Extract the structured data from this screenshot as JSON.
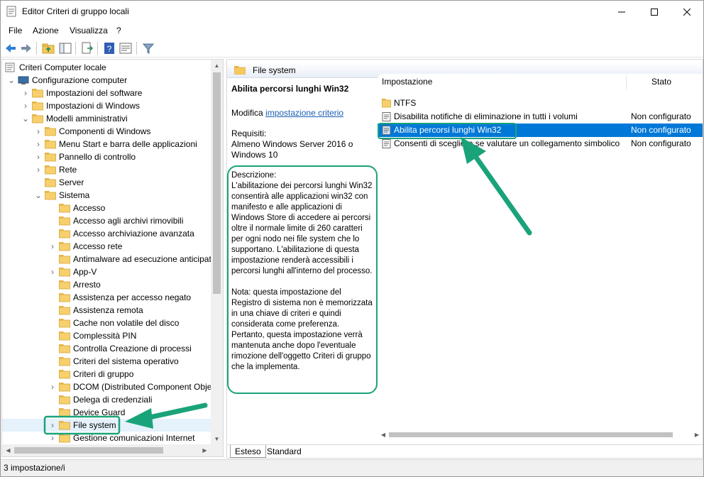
{
  "window": {
    "title": "Editor Criteri di gruppo locali"
  },
  "menu": [
    "File",
    "Azione",
    "Visualizza",
    "?"
  ],
  "tree": [
    {
      "label": "Criteri Computer locale",
      "level": 0,
      "chevron": "",
      "icon": "computer-icon"
    },
    {
      "label": "Configurazione computer",
      "level": 1,
      "chevron": "open",
      "icon": "settings-icon"
    },
    {
      "label": "Impostazioni del software",
      "level": 2,
      "chevron": "closed",
      "icon": "folder-icon"
    },
    {
      "label": "Impostazioni di Windows",
      "level": 2,
      "chevron": "closed",
      "icon": "folder-icon"
    },
    {
      "label": "Modelli amministrativi",
      "level": 2,
      "chevron": "open",
      "icon": "folder-icon"
    },
    {
      "label": "Componenti di Windows",
      "level": 3,
      "chevron": "closed",
      "icon": "folder-icon"
    },
    {
      "label": "Menu Start e barra delle applicazioni",
      "level": 3,
      "chevron": "closed",
      "icon": "folder-icon"
    },
    {
      "label": "Pannello di controllo",
      "level": 3,
      "chevron": "closed",
      "icon": "folder-icon"
    },
    {
      "label": "Rete",
      "level": 3,
      "chevron": "closed",
      "icon": "folder-icon"
    },
    {
      "label": "Server",
      "level": 3,
      "chevron": "",
      "icon": "folder-icon"
    },
    {
      "label": "Sistema",
      "level": 3,
      "chevron": "open",
      "icon": "folder-icon"
    },
    {
      "label": "Accesso",
      "level": 4,
      "chevron": "",
      "icon": "folder-icon"
    },
    {
      "label": "Accesso agli archivi rimovibili",
      "level": 4,
      "chevron": "",
      "icon": "folder-icon"
    },
    {
      "label": "Accesso archiviazione avanzata",
      "level": 4,
      "chevron": "",
      "icon": "folder-icon"
    },
    {
      "label": "Accesso rete",
      "level": 4,
      "chevron": "closed",
      "icon": "folder-icon"
    },
    {
      "label": "Antimalware ad esecuzione anticipat",
      "level": 4,
      "chevron": "",
      "icon": "folder-icon"
    },
    {
      "label": "App-V",
      "level": 4,
      "chevron": "closed",
      "icon": "folder-icon"
    },
    {
      "label": "Arresto",
      "level": 4,
      "chevron": "",
      "icon": "folder-icon"
    },
    {
      "label": "Assistenza per accesso negato",
      "level": 4,
      "chevron": "",
      "icon": "folder-icon"
    },
    {
      "label": "Assistenza remota",
      "level": 4,
      "chevron": "",
      "icon": "folder-icon"
    },
    {
      "label": "Cache non volatile del disco",
      "level": 4,
      "chevron": "",
      "icon": "folder-icon"
    },
    {
      "label": "Complessità PIN",
      "level": 4,
      "chevron": "",
      "icon": "folder-icon"
    },
    {
      "label": "Controlla Creazione di processi",
      "level": 4,
      "chevron": "",
      "icon": "folder-icon"
    },
    {
      "label": "Criteri del sistema operativo",
      "level": 4,
      "chevron": "",
      "icon": "folder-icon"
    },
    {
      "label": "Criteri di gruppo",
      "level": 4,
      "chevron": "",
      "icon": "folder-icon"
    },
    {
      "label": "DCOM (Distributed Component Obje",
      "level": 4,
      "chevron": "closed",
      "icon": "folder-icon"
    },
    {
      "label": "Delega di credenziali",
      "level": 4,
      "chevron": "",
      "icon": "folder-icon"
    },
    {
      "label": "Device Guard",
      "level": 4,
      "chevron": "",
      "icon": "folder-icon"
    },
    {
      "label": "File system",
      "level": 4,
      "chevron": "closed",
      "icon": "folder-icon",
      "selected": true
    },
    {
      "label": "Gestione comunicazioni Internet",
      "level": 4,
      "chevron": "closed",
      "icon": "folder-icon"
    }
  ],
  "right": {
    "header": "File system",
    "description": {
      "title": "Abilita percorsi lunghi Win32",
      "modify_prefix": "Modifica",
      "modify_link": "impostazione criterio",
      "requirements": "Requisiti:\nAlmeno Windows Server 2016 o Windows 10",
      "paragraph1": "Descrizione:\nL'abilitazione dei percorsi lunghi Win32 consentirà alle applicazioni win32 con manifesto e alle applicazioni di Windows Store di accedere ai percorsi oltre il normale limite di 260 caratteri per ogni nodo nei file system che lo supportano. L'abilitazione di questa impostazione renderà accessibili i percorsi lunghi all'interno del processo.",
      "paragraph2": "Nota: questa impostazione del Registro di sistema non è memorizzata in una chiave di criteri e quindi considerata come preferenza. Pertanto, questa impostazione verrà mantenuta anche dopo l'eventuale rimozione dell'oggetto Criteri di gruppo che la implementa."
    },
    "columns": {
      "setting": "Impostazione",
      "state": "Stato"
    },
    "rows": [
      {
        "name": "NTFS",
        "state": "",
        "icon": "folder-icon"
      },
      {
        "name": "Disabilita notifiche di eliminazione in tutti i volumi",
        "state": "Non configurato",
        "icon": "policy-icon"
      },
      {
        "name": "Abilita percorsi lunghi Win32",
        "state": "Non configurato",
        "icon": "policy-icon",
        "selected": true
      },
      {
        "name": "Consenti di scegliere se valutare un collegamento simbolico",
        "state": "Non configurato",
        "icon": "policy-icon"
      }
    ],
    "tabs": [
      "Esteso",
      "Standard"
    ]
  },
  "status": {
    "text": "3 impostazione/i"
  },
  "colors": {
    "accent": "#0078d7",
    "callout": "#1aa37a",
    "folder": "#f4c95d"
  }
}
